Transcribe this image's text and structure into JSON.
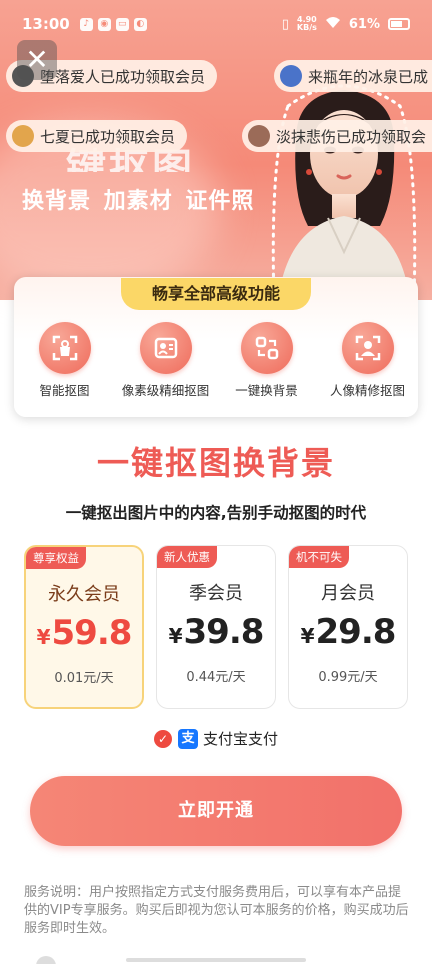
{
  "status_bar": {
    "time": "13:00",
    "net_speed": "4.90",
    "net_unit": "KB/s",
    "battery": "61%"
  },
  "hero": {
    "title_partial": "键抠图",
    "subtitle": "换背景 加素材 证件照",
    "danmu": [
      {
        "text": "堕落爱人已成功领取会员"
      },
      {
        "text": "来瓶年的冰泉已成"
      },
      {
        "text": "七夏已成功领取会员"
      },
      {
        "text": "淡抹悲伤已成功领取会"
      }
    ]
  },
  "features": {
    "tag": "畅享全部高级功能",
    "items": [
      {
        "label": "智能抠图",
        "icon": "smart-cutout-icon"
      },
      {
        "label": "像素级精细抠图",
        "icon": "pixel-cutout-icon"
      },
      {
        "label": "一键换背景",
        "icon": "swap-background-icon"
      },
      {
        "label": "人像精修抠图",
        "icon": "portrait-retouch-icon"
      }
    ]
  },
  "main": {
    "title": "一键抠图换背景",
    "subtitle": "一键抠出图片中的内容,告别手动抠图的时代"
  },
  "plans": [
    {
      "badge": "尊享权益",
      "name": "永久会员",
      "currency": "¥",
      "price": "59.8",
      "per_day": "0.01元/天",
      "selected": true
    },
    {
      "badge": "新人优惠",
      "name": "季会员",
      "currency": "¥",
      "price": "39.8",
      "per_day": "0.44元/天",
      "selected": false
    },
    {
      "badge": "机不可失",
      "name": "月会员",
      "currency": "¥",
      "price": "29.8",
      "per_day": "0.99元/天",
      "selected": false
    }
  ],
  "payment": {
    "method": "支付宝支付",
    "alipay_glyph": "支"
  },
  "cta": {
    "label": "立即开通"
  },
  "notice": "服务说明：用户按照指定方式支付服务费用后，可以享有本产品提供的VIP专享服务。购买后即视为您认可本服务的价格，购买成功后服务即时生效。",
  "colors": {
    "accent": "#ee5b55",
    "hero_bg": "#f58a78",
    "gold": "#fbd767",
    "selected_border": "#f7d37a",
    "alipay": "#1677ff"
  }
}
